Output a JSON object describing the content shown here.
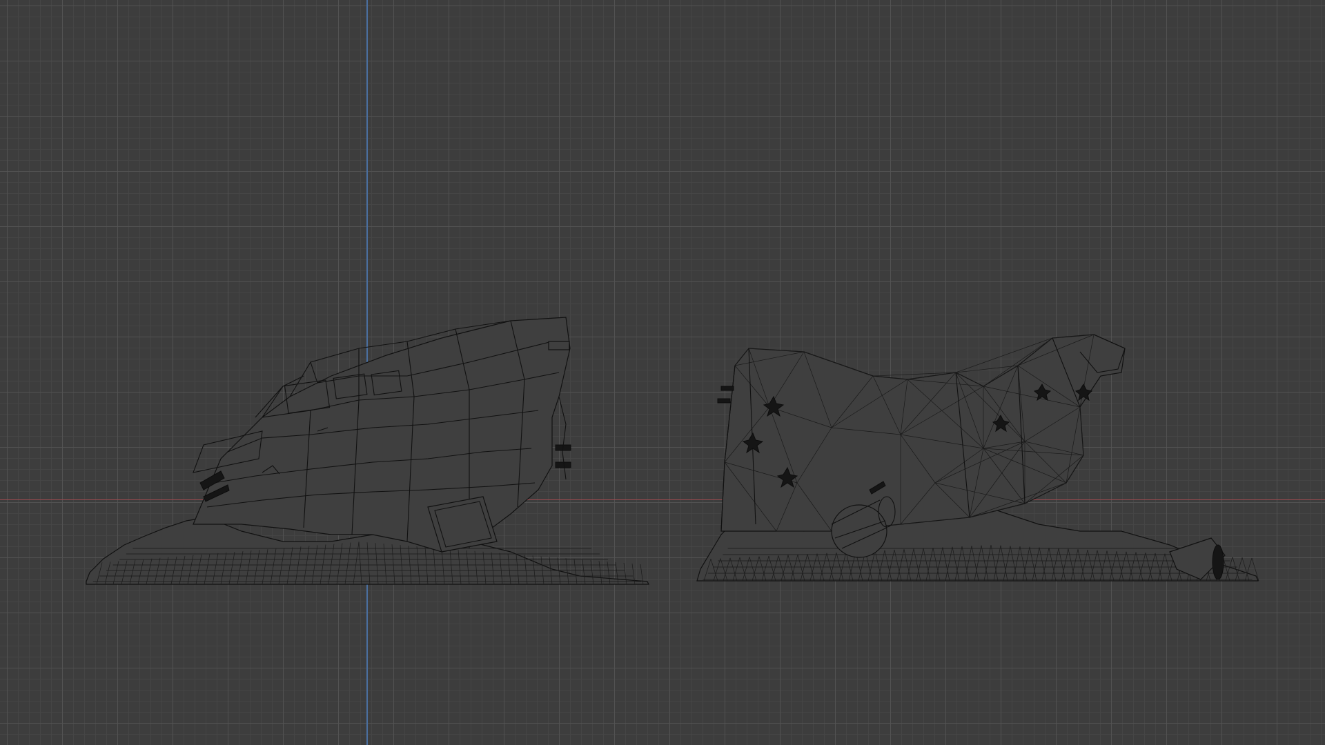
{
  "viewport": {
    "mode": "wireframe",
    "view": "front-orthographic",
    "background_color": "#3d3d3d",
    "grid": true,
    "axis_colors": {
      "x": "#9a4a4f",
      "z": "#4a6fa0"
    },
    "wire_color": "#111111"
  },
  "objects": [
    {
      "name": "wrecked-vehicle-low-poly"
    },
    {
      "name": "wrecked-vehicle-triangulated"
    }
  ]
}
